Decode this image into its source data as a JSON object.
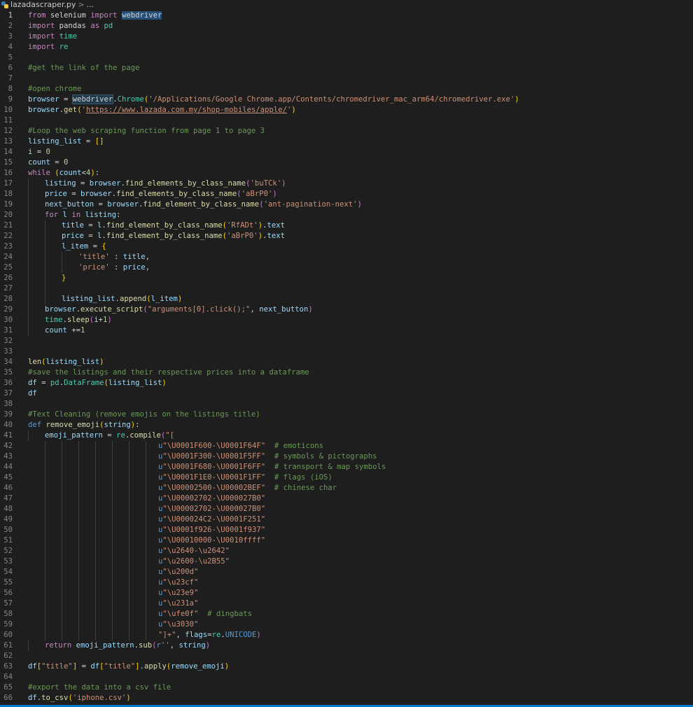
{
  "breadcrumb": {
    "filename": "lazadascraper.py",
    "separator": ">",
    "ellipsis": "..."
  },
  "lines": [
    {
      "n": "1",
      "segs": [
        [
          "kw",
          "from"
        ],
        [
          "op",
          " selenium "
        ],
        [
          "kw",
          "import"
        ],
        [
          "op",
          " "
        ],
        [
          "hl",
          "webdriver"
        ]
      ]
    },
    {
      "n": "2",
      "segs": [
        [
          "kw",
          "import"
        ],
        [
          "op",
          " pandas "
        ],
        [
          "kw",
          "as"
        ],
        [
          "op",
          " "
        ],
        [
          "cls",
          "pd"
        ]
      ]
    },
    {
      "n": "3",
      "segs": [
        [
          "kw",
          "import"
        ],
        [
          "op",
          " "
        ],
        [
          "cls",
          "time"
        ]
      ]
    },
    {
      "n": "4",
      "segs": [
        [
          "kw",
          "import"
        ],
        [
          "op",
          " "
        ],
        [
          "cls",
          "re"
        ]
      ]
    },
    {
      "n": "5",
      "segs": []
    },
    {
      "n": "6",
      "segs": [
        [
          "cmt",
          "#get the link of the page"
        ]
      ]
    },
    {
      "n": "7",
      "segs": []
    },
    {
      "n": "8",
      "segs": [
        [
          "cmt",
          "#open chrome"
        ]
      ]
    },
    {
      "n": "9",
      "segs": [
        [
          "var",
          "browser"
        ],
        [
          "op",
          " = "
        ],
        [
          "hl2",
          "webdriver"
        ],
        [
          "op",
          "."
        ],
        [
          "cls",
          "Chrome"
        ],
        [
          "br",
          "("
        ],
        [
          "str",
          "'/Applications/Google Chrome.app/Contents/chromedriver_mac_arm64/chromedriver.exe'"
        ],
        [
          "br",
          ")"
        ]
      ]
    },
    {
      "n": "10",
      "segs": [
        [
          "var",
          "browser"
        ],
        [
          "op",
          "."
        ],
        [
          "fn",
          "get"
        ],
        [
          "br",
          "("
        ],
        [
          "str",
          "'"
        ],
        [
          "url",
          "https://www.lazada.com.my/shop-mobiles/apple/"
        ],
        [
          "str",
          "'"
        ],
        [
          "br",
          ")"
        ]
      ]
    },
    {
      "n": "11",
      "segs": []
    },
    {
      "n": "12",
      "segs": [
        [
          "cmt",
          "#Loop the web scraping function from page 1 to page 3"
        ]
      ]
    },
    {
      "n": "13",
      "segs": [
        [
          "var",
          "listing_list"
        ],
        [
          "op",
          " = "
        ],
        [
          "br",
          "[]"
        ]
      ]
    },
    {
      "n": "14",
      "segs": [
        [
          "var",
          "i"
        ],
        [
          "op",
          " = "
        ],
        [
          "num",
          "0"
        ]
      ]
    },
    {
      "n": "15",
      "segs": [
        [
          "var",
          "count"
        ],
        [
          "op",
          " = "
        ],
        [
          "num",
          "0"
        ]
      ]
    },
    {
      "n": "16",
      "segs": [
        [
          "kw",
          "while"
        ],
        [
          "op",
          " "
        ],
        [
          "br",
          "("
        ],
        [
          "var",
          "count"
        ],
        [
          "op",
          "<"
        ],
        [
          "num",
          "4"
        ],
        [
          "br",
          ")"
        ],
        [
          "op",
          ":"
        ]
      ]
    },
    {
      "n": "17",
      "ind": 1,
      "segs": [
        [
          "var",
          "listing"
        ],
        [
          "op",
          " = "
        ],
        [
          "var",
          "browser"
        ],
        [
          "op",
          "."
        ],
        [
          "fn",
          "find_elements_by_class_name"
        ],
        [
          "br2",
          "("
        ],
        [
          "str",
          "'buTCk'"
        ],
        [
          "br2",
          ")"
        ]
      ]
    },
    {
      "n": "18",
      "ind": 1,
      "segs": [
        [
          "var",
          "price"
        ],
        [
          "op",
          " = "
        ],
        [
          "var",
          "browser"
        ],
        [
          "op",
          "."
        ],
        [
          "fn",
          "find_elements_by_class_name"
        ],
        [
          "br2",
          "("
        ],
        [
          "str",
          "'aBrP0'"
        ],
        [
          "br2",
          ")"
        ]
      ]
    },
    {
      "n": "19",
      "ind": 1,
      "segs": [
        [
          "var",
          "next_button"
        ],
        [
          "op",
          " = "
        ],
        [
          "var",
          "browser"
        ],
        [
          "op",
          "."
        ],
        [
          "fn",
          "find_element_by_class_name"
        ],
        [
          "br2",
          "("
        ],
        [
          "str",
          "'ant-pagination-next'"
        ],
        [
          "br2",
          ")"
        ]
      ]
    },
    {
      "n": "20",
      "ind": 1,
      "segs": [
        [
          "kw",
          "for"
        ],
        [
          "op",
          " "
        ],
        [
          "var",
          "l"
        ],
        [
          "op",
          " "
        ],
        [
          "kw",
          "in"
        ],
        [
          "op",
          " "
        ],
        [
          "var",
          "listing"
        ],
        [
          "op",
          ":"
        ]
      ]
    },
    {
      "n": "21",
      "ind": 2,
      "segs": [
        [
          "var",
          "title"
        ],
        [
          "op",
          " = "
        ],
        [
          "var",
          "l"
        ],
        [
          "op",
          "."
        ],
        [
          "fn",
          "find_element_by_class_name"
        ],
        [
          "br",
          "("
        ],
        [
          "str",
          "'RfADt'"
        ],
        [
          "br",
          ")"
        ],
        [
          "op",
          "."
        ],
        [
          "var",
          "text"
        ]
      ]
    },
    {
      "n": "22",
      "ind": 2,
      "segs": [
        [
          "var",
          "price"
        ],
        [
          "op",
          " = "
        ],
        [
          "var",
          "l"
        ],
        [
          "op",
          "."
        ],
        [
          "fn",
          "find_element_by_class_name"
        ],
        [
          "br",
          "("
        ],
        [
          "str",
          "'aBrP0'"
        ],
        [
          "br",
          ")"
        ],
        [
          "op",
          "."
        ],
        [
          "var",
          "text"
        ]
      ]
    },
    {
      "n": "23",
      "ind": 2,
      "segs": [
        [
          "var",
          "l_item"
        ],
        [
          "op",
          " = "
        ],
        [
          "br",
          "{"
        ]
      ]
    },
    {
      "n": "24",
      "ind": 3,
      "segs": [
        [
          "str",
          "'title'"
        ],
        [
          "op",
          " : "
        ],
        [
          "var",
          "title"
        ],
        [
          "op",
          ","
        ]
      ]
    },
    {
      "n": "25",
      "ind": 3,
      "segs": [
        [
          "str",
          "'price'"
        ],
        [
          "op",
          " : "
        ],
        [
          "var",
          "price"
        ],
        [
          "op",
          ","
        ]
      ]
    },
    {
      "n": "26",
      "ind": 2,
      "segs": [
        [
          "br",
          "}"
        ]
      ]
    },
    {
      "n": "27",
      "ind": 2,
      "segs": []
    },
    {
      "n": "28",
      "ind": 2,
      "segs": [
        [
          "var",
          "listing_list"
        ],
        [
          "op",
          "."
        ],
        [
          "fn",
          "append"
        ],
        [
          "br",
          "("
        ],
        [
          "var",
          "l_item"
        ],
        [
          "br",
          ")"
        ]
      ]
    },
    {
      "n": "29",
      "ind": 1,
      "segs": [
        [
          "var",
          "browser"
        ],
        [
          "op",
          "."
        ],
        [
          "fn",
          "execute_script"
        ],
        [
          "br2",
          "("
        ],
        [
          "str",
          "\"arguments[0].click();\""
        ],
        [
          "op",
          ", "
        ],
        [
          "var",
          "next_button"
        ],
        [
          "br2",
          ")"
        ]
      ]
    },
    {
      "n": "30",
      "ind": 1,
      "segs": [
        [
          "cls",
          "time"
        ],
        [
          "op",
          "."
        ],
        [
          "fn",
          "sleep"
        ],
        [
          "br2",
          "("
        ],
        [
          "var",
          "i"
        ],
        [
          "op",
          "+"
        ],
        [
          "num",
          "1"
        ],
        [
          "br2",
          ")"
        ]
      ]
    },
    {
      "n": "31",
      "ind": 1,
      "segs": [
        [
          "var",
          "count"
        ],
        [
          "op",
          " +="
        ],
        [
          "num",
          "1"
        ]
      ]
    },
    {
      "n": "32",
      "segs": []
    },
    {
      "n": "33",
      "segs": []
    },
    {
      "n": "34",
      "segs": [
        [
          "fn",
          "len"
        ],
        [
          "br",
          "("
        ],
        [
          "var",
          "listing_list"
        ],
        [
          "br",
          ")"
        ]
      ]
    },
    {
      "n": "35",
      "segs": [
        [
          "cmt",
          "#save the listings and their respective prices into a dataframe"
        ]
      ]
    },
    {
      "n": "36",
      "segs": [
        [
          "var",
          "df"
        ],
        [
          "op",
          " = "
        ],
        [
          "cls",
          "pd"
        ],
        [
          "op",
          "."
        ],
        [
          "cls",
          "DataFrame"
        ],
        [
          "br",
          "("
        ],
        [
          "var",
          "listing_list"
        ],
        [
          "br",
          ")"
        ]
      ]
    },
    {
      "n": "37",
      "segs": [
        [
          "var",
          "df"
        ]
      ]
    },
    {
      "n": "38",
      "segs": []
    },
    {
      "n": "39",
      "segs": [
        [
          "cmt",
          "#Text Cleaning (remove emojis on the listings title)"
        ]
      ]
    },
    {
      "n": "40",
      "segs": [
        [
          "kwb",
          "def"
        ],
        [
          "op",
          " "
        ],
        [
          "fn",
          "remove_emoji"
        ],
        [
          "br",
          "("
        ],
        [
          "var",
          "string"
        ],
        [
          "br",
          ")"
        ],
        [
          "op",
          ":"
        ]
      ]
    },
    {
      "n": "41",
      "ind": 1,
      "segs": [
        [
          "var",
          "emoji_pattern"
        ],
        [
          "op",
          " = "
        ],
        [
          "cls",
          "re"
        ],
        [
          "op",
          "."
        ],
        [
          "fn",
          "compile"
        ],
        [
          "br2",
          "("
        ],
        [
          "str",
          "\"["
        ]
      ]
    },
    {
      "n": "42",
      "deep": true,
      "segs": [
        [
          "kwb",
          "u"
        ],
        [
          "str",
          "\"\\U0001F600-\\U0001F64F\""
        ],
        [
          "op",
          "  "
        ],
        [
          "cmt",
          "# emoticons"
        ]
      ]
    },
    {
      "n": "43",
      "deep": true,
      "segs": [
        [
          "kwb",
          "u"
        ],
        [
          "str",
          "\"\\U0001F300-\\U0001F5FF\""
        ],
        [
          "op",
          "  "
        ],
        [
          "cmt",
          "# symbols & pictographs"
        ]
      ]
    },
    {
      "n": "44",
      "deep": true,
      "segs": [
        [
          "kwb",
          "u"
        ],
        [
          "str",
          "\"\\U0001F680-\\U0001F6FF\""
        ],
        [
          "op",
          "  "
        ],
        [
          "cmt",
          "# transport & map symbols"
        ]
      ]
    },
    {
      "n": "45",
      "deep": true,
      "segs": [
        [
          "kwb",
          "u"
        ],
        [
          "str",
          "\"\\U0001F1E0-\\U0001F1FF\""
        ],
        [
          "op",
          "  "
        ],
        [
          "cmt",
          "# flags (iOS)"
        ]
      ]
    },
    {
      "n": "46",
      "deep": true,
      "segs": [
        [
          "kwb",
          "u"
        ],
        [
          "str",
          "\"\\U00002500-\\U00002BEF\""
        ],
        [
          "op",
          "  "
        ],
        [
          "cmt",
          "# chinese char"
        ]
      ]
    },
    {
      "n": "47",
      "deep": true,
      "segs": [
        [
          "kwb",
          "u"
        ],
        [
          "str",
          "\"\\U00002702-\\U000027B0\""
        ]
      ]
    },
    {
      "n": "48",
      "deep": true,
      "segs": [
        [
          "kwb",
          "u"
        ],
        [
          "str",
          "\"\\U00002702-\\U000027B0\""
        ]
      ]
    },
    {
      "n": "49",
      "deep": true,
      "segs": [
        [
          "kwb",
          "u"
        ],
        [
          "str",
          "\"\\U000024C2-\\U0001F251\""
        ]
      ]
    },
    {
      "n": "50",
      "deep": true,
      "segs": [
        [
          "kwb",
          "u"
        ],
        [
          "str",
          "\"\\U0001f926-\\U0001f937\""
        ]
      ]
    },
    {
      "n": "51",
      "deep": true,
      "segs": [
        [
          "kwb",
          "u"
        ],
        [
          "str",
          "\"\\U00010000-\\U0010ffff\""
        ]
      ]
    },
    {
      "n": "52",
      "deep": true,
      "segs": [
        [
          "kwb",
          "u"
        ],
        [
          "str",
          "\"\\u2640-\\u2642\""
        ]
      ]
    },
    {
      "n": "53",
      "deep": true,
      "segs": [
        [
          "kwb",
          "u"
        ],
        [
          "str",
          "\"\\u2600-\\u2B55\""
        ]
      ]
    },
    {
      "n": "54",
      "deep": true,
      "segs": [
        [
          "kwb",
          "u"
        ],
        [
          "str",
          "\"\\u200d\""
        ]
      ]
    },
    {
      "n": "55",
      "deep": true,
      "segs": [
        [
          "kwb",
          "u"
        ],
        [
          "str",
          "\"\\u23cf\""
        ]
      ]
    },
    {
      "n": "56",
      "deep": true,
      "segs": [
        [
          "kwb",
          "u"
        ],
        [
          "str",
          "\"\\u23e9\""
        ]
      ]
    },
    {
      "n": "57",
      "deep": true,
      "segs": [
        [
          "kwb",
          "u"
        ],
        [
          "str",
          "\"\\u231a\""
        ]
      ]
    },
    {
      "n": "58",
      "deep": true,
      "segs": [
        [
          "kwb",
          "u"
        ],
        [
          "str",
          "\"\\ufe0f\""
        ],
        [
          "op",
          "  "
        ],
        [
          "cmt",
          "# dingbats"
        ]
      ]
    },
    {
      "n": "59",
      "deep": true,
      "segs": [
        [
          "kwb",
          "u"
        ],
        [
          "str",
          "\"\\u3030\""
        ]
      ]
    },
    {
      "n": "60",
      "deep": true,
      "segs": [
        [
          "str",
          "\"]+\""
        ],
        [
          "op",
          ", "
        ],
        [
          "var",
          "flags"
        ],
        [
          "op",
          "="
        ],
        [
          "cls",
          "re"
        ],
        [
          "op",
          "."
        ],
        [
          "kwb",
          "UNICODE"
        ],
        [
          "br2",
          ")"
        ]
      ]
    },
    {
      "n": "61",
      "ind": 1,
      "segs": [
        [
          "kw",
          "return"
        ],
        [
          "op",
          " "
        ],
        [
          "var",
          "emoji_pattern"
        ],
        [
          "op",
          "."
        ],
        [
          "fn",
          "sub"
        ],
        [
          "br2",
          "("
        ],
        [
          "kwb",
          "r"
        ],
        [
          "str",
          "''"
        ],
        [
          "op",
          ", "
        ],
        [
          "var",
          "string"
        ],
        [
          "br2",
          ")"
        ]
      ]
    },
    {
      "n": "62",
      "segs": []
    },
    {
      "n": "63",
      "segs": [
        [
          "var",
          "df"
        ],
        [
          "br",
          "["
        ],
        [
          "str",
          "\"title\""
        ],
        [
          "br",
          "]"
        ],
        [
          "op",
          " = "
        ],
        [
          "var",
          "df"
        ],
        [
          "br",
          "["
        ],
        [
          "str",
          "\"title\""
        ],
        [
          "br",
          "]"
        ],
        [
          "op",
          "."
        ],
        [
          "fn",
          "apply"
        ],
        [
          "br",
          "("
        ],
        [
          "var",
          "remove_emoji"
        ],
        [
          "br",
          ")"
        ]
      ]
    },
    {
      "n": "64",
      "segs": []
    },
    {
      "n": "65",
      "segs": [
        [
          "cmt",
          "#export the data into a csv file"
        ]
      ]
    },
    {
      "n": "66",
      "segs": [
        [
          "var",
          "df"
        ],
        [
          "op",
          "."
        ],
        [
          "fn",
          "to_csv"
        ],
        [
          "br",
          "("
        ],
        [
          "str",
          "'iphone.csv'"
        ],
        [
          "br",
          ")"
        ]
      ]
    }
  ]
}
